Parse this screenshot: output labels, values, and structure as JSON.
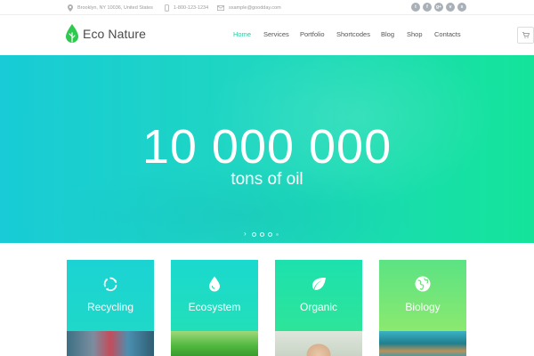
{
  "topbar": {
    "address": "Brooklyn, NY 10036, United States",
    "phone": "1-800-123-1234",
    "email": "sxample@goodday.com",
    "social": [
      "t",
      "f",
      "g+",
      "v",
      "s"
    ]
  },
  "header": {
    "logo_text": "Eco Nature",
    "nav": [
      {
        "label": "Home",
        "active": true
      },
      {
        "label": "Services",
        "active": false
      },
      {
        "label": "Portfolio",
        "active": false
      },
      {
        "label": "Shortcodes",
        "active": false
      },
      {
        "label": "Blog",
        "active": false
      },
      {
        "label": "Shop",
        "active": false
      },
      {
        "label": "Contacts",
        "active": false
      }
    ],
    "cart_icon": "cart-icon"
  },
  "hero": {
    "number": "10 000 000",
    "subtitle": "tons of oil",
    "slides_total": 4,
    "active_slide": 1
  },
  "cards": [
    {
      "label": "Recycling",
      "icon": "recycle-icon",
      "color_top": "#1bd3d3",
      "color_bottom": "#1fd8c9"
    },
    {
      "label": "Ecosystem",
      "icon": "water-drop-icon",
      "color_top": "#1ad9cf",
      "color_bottom": "#22dfb9"
    },
    {
      "label": "Organic",
      "icon": "leaf-icon",
      "color_top": "#1ce1ae",
      "color_bottom": "#2ee49a"
    },
    {
      "label": "Biology",
      "icon": "globe-icon",
      "color_top": "#5be383",
      "color_bottom": "#8be96f"
    }
  ],
  "colors": {
    "accent": "#2fc99a",
    "hero_left": "#18cbd6",
    "hero_right": "#14e49a"
  }
}
